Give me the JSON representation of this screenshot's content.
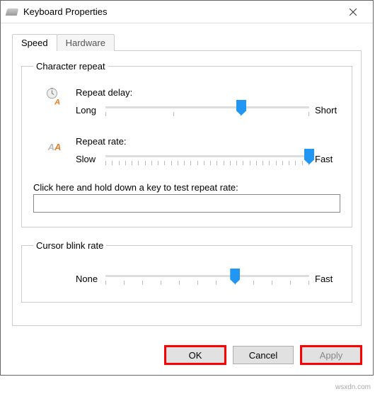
{
  "window": {
    "title": "Keyboard Properties"
  },
  "tabs": {
    "speed": "Speed",
    "hardware": "Hardware"
  },
  "charRepeat": {
    "legend": "Character repeat",
    "delay": {
      "label": "Repeat delay:",
      "leftLabel": "Long",
      "rightLabel": "Short",
      "value": 2,
      "max": 3
    },
    "rate": {
      "label": "Repeat rate:",
      "leftLabel": "Slow",
      "rightLabel": "Fast",
      "value": 31,
      "max": 31
    },
    "testLabel": "Click here and hold down a key to test repeat rate:",
    "testValue": ""
  },
  "cursor": {
    "legend": "Cursor blink rate",
    "leftLabel": "None",
    "rightLabel": "Fast",
    "value": 7,
    "max": 11
  },
  "buttons": {
    "ok": "OK",
    "cancel": "Cancel",
    "apply": "Apply"
  },
  "watermark": "wsxdn.com"
}
